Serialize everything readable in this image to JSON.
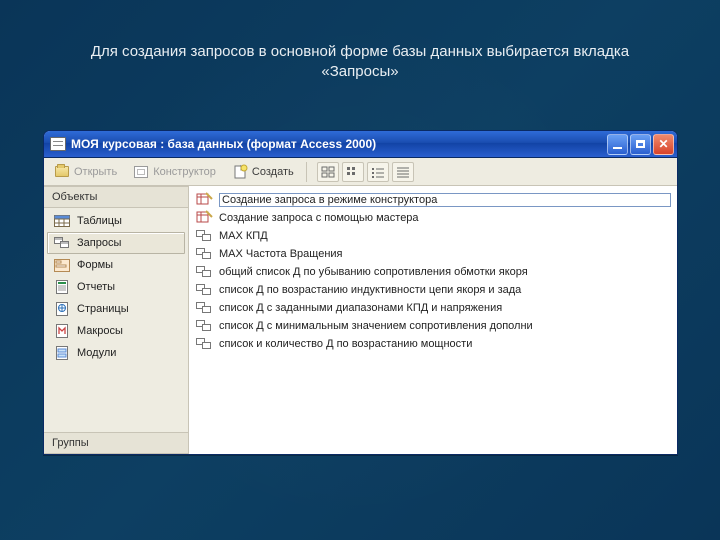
{
  "caption": "Для создания запросов в основной форме базы данных выбирается вкладка «Запросы»",
  "window": {
    "title": "МОЯ курсовая : база данных (формат Access 2000)"
  },
  "toolbar": {
    "open": "Открыть",
    "design": "Конструктор",
    "create": "Создать"
  },
  "sidebar": {
    "header_objects": "Объекты",
    "header_groups": "Группы",
    "items": [
      {
        "label": "Таблицы"
      },
      {
        "label": "Запросы"
      },
      {
        "label": "Формы"
      },
      {
        "label": "Отчеты"
      },
      {
        "label": "Страницы"
      },
      {
        "label": "Макросы"
      },
      {
        "label": "Модули"
      }
    ]
  },
  "list": [
    {
      "label": "Создание запроса в режиме конструктора"
    },
    {
      "label": "Создание запроса с помощью мастера"
    },
    {
      "label": "MAX КПД"
    },
    {
      "label": "MAX Частота Вращения"
    },
    {
      "label": "общий список Д по убыванию сопротивления обмотки якоря"
    },
    {
      "label": "список Д по возрастанию индуктивности цепи якоря и зада"
    },
    {
      "label": "список Д с заданными диапазонами КПД и напряжения"
    },
    {
      "label": "список Д с минимальным значением сопротивления дополни"
    },
    {
      "label": "список и количество Д  по возрастанию мощности"
    }
  ]
}
